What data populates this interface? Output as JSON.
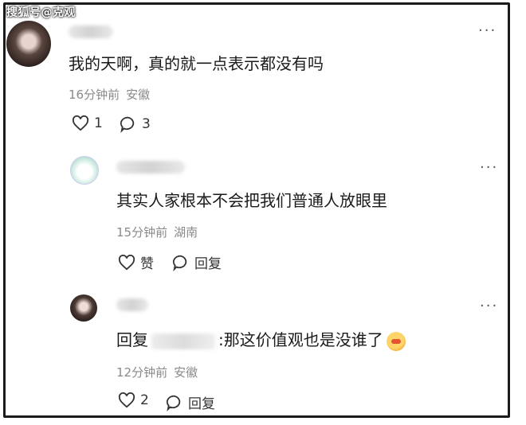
{
  "watermark": "搜狐号@克观",
  "comments": [
    {
      "text": "我的天啊，真的就一点表示都没有吗",
      "time": "16分钟前",
      "location": "安徽",
      "like_count": "1",
      "reply_count": "3",
      "more": "···"
    },
    {
      "text": "其实人家根本不会把我们普通人放眼里",
      "time": "15分钟前",
      "location": "湖南",
      "like_label": "赞",
      "reply_label": "回复",
      "more": "···"
    },
    {
      "reply_prefix": "回复",
      "text": ":那这价值观也是没谁了",
      "time": "12分钟前",
      "location": "安徽",
      "like_count": "2",
      "reply_label": "回复",
      "more": "···"
    }
  ]
}
